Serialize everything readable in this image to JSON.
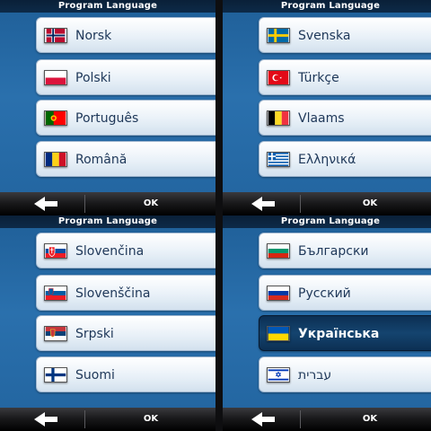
{
  "panels": [
    {
      "title": "Program Language",
      "ok_label": "OK",
      "items": [
        {
          "label": "Norsk",
          "flag": "norway-flag-icon"
        },
        {
          "label": "Polski",
          "flag": "poland-flag-icon"
        },
        {
          "label": "Português",
          "flag": "portugal-flag-icon"
        },
        {
          "label": "Română",
          "flag": "romania-flag-icon"
        }
      ]
    },
    {
      "title": "Program Language",
      "ok_label": "OK",
      "items": [
        {
          "label": "Svenska",
          "flag": "sweden-flag-icon"
        },
        {
          "label": "Türkçe",
          "flag": "turkey-flag-icon"
        },
        {
          "label": "Vlaams",
          "flag": "belgium-flag-icon"
        },
        {
          "label": "Ελληνικά",
          "flag": "greece-flag-icon"
        }
      ]
    },
    {
      "title": "Program Language",
      "ok_label": "OK",
      "items": [
        {
          "label": "Slovenčina",
          "flag": "slovakia-flag-icon"
        },
        {
          "label": "Slovenščina",
          "flag": "slovenia-flag-icon"
        },
        {
          "label": "Srpski",
          "flag": "serbia-flag-icon"
        },
        {
          "label": "Suomi",
          "flag": "finland-flag-icon"
        }
      ]
    },
    {
      "title": "Program Language",
      "ok_label": "OK",
      "items": [
        {
          "label": "Български",
          "flag": "bulgaria-flag-icon"
        },
        {
          "label": "Русский",
          "flag": "russia-flag-icon"
        },
        {
          "label": "Українська",
          "flag": "ukraine-flag-icon",
          "selected": true
        },
        {
          "label": "עברית",
          "flag": "israel-flag-icon"
        }
      ]
    }
  ],
  "colors": {
    "selected_item": "#0c2f53",
    "item_text": "#1e3758",
    "panel_blue": "#2a70ad"
  }
}
